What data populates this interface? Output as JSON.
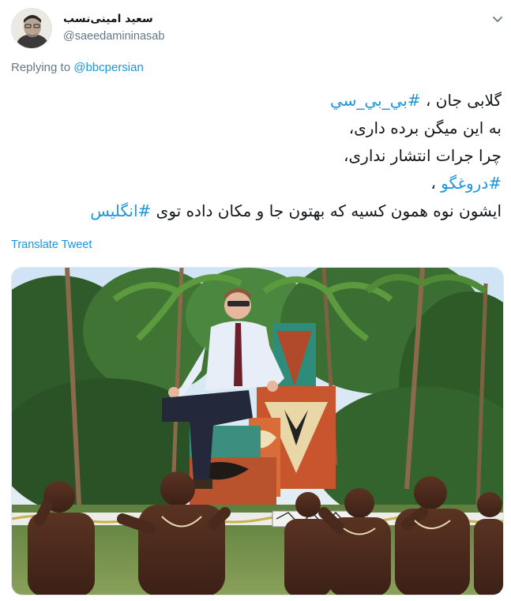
{
  "author": {
    "display_name": "سعید امینی‌نسب",
    "handle": "@saeedamininasab",
    "avatar_icon": "user-avatar"
  },
  "reply": {
    "prefix": "Replying to",
    "mention": "@bbcpersian"
  },
  "tweet": {
    "line1_text": "گلابی جان ، ",
    "line1_hashtag": "#بي_بي_سي",
    "line2": "به این میگن برده داری،",
    "line3": "چرا جرات انتشار نداری،",
    "line4_hashtag": "#دروغگو",
    "line4_text": " ،",
    "line5_text": "ایشون نوه همون کسیه که بهتون جا و مکان داده توی ",
    "line5_hashtag": "#انگلیس"
  },
  "translate_label": "Translate Tweet",
  "colors": {
    "link": "#1b95e0",
    "muted": "#657786",
    "text": "#14171a"
  },
  "media": {
    "icon": "photo-image"
  },
  "menu": {
    "icon": "chevron-down-icon"
  }
}
